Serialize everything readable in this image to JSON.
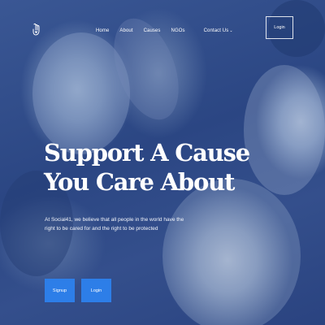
{
  "nav": {
    "logo_icon": "hand-heart-icon",
    "items": [
      {
        "label": "Home"
      },
      {
        "label": "About"
      },
      {
        "label": "Causes"
      },
      {
        "label": "NGOs"
      },
      {
        "label": "Contact Us"
      }
    ],
    "contact_caret": "⌄",
    "login_label": "Login"
  },
  "hero": {
    "title_line1": "Support A Cause",
    "title_line2": "You Care About",
    "subtitle": "At Social41, we believe that all people in the world have the right to be cared for and the right to be protected",
    "signup_label": "Signup",
    "login_label": "Login"
  },
  "colors": {
    "overlay": "#2d4a86",
    "button": "#2d7ee8",
    "text": "#ffffff"
  }
}
